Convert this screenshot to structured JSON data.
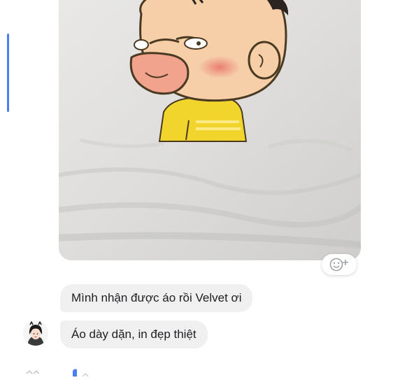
{
  "conversation": {
    "accent_color": "#4a7ef5",
    "photo": {
      "icon": "shared-photo-cartoon-tshirt"
    },
    "reaction": {
      "icon": "add-reaction-icon"
    },
    "messages": [
      {
        "text": "Mình nhận được áo rồi Velvet ơi"
      },
      {
        "text": "Áo dày dặn, in đẹp thiệt"
      }
    ],
    "sender": {
      "avatar_icon": "user-avatar-icon"
    }
  }
}
